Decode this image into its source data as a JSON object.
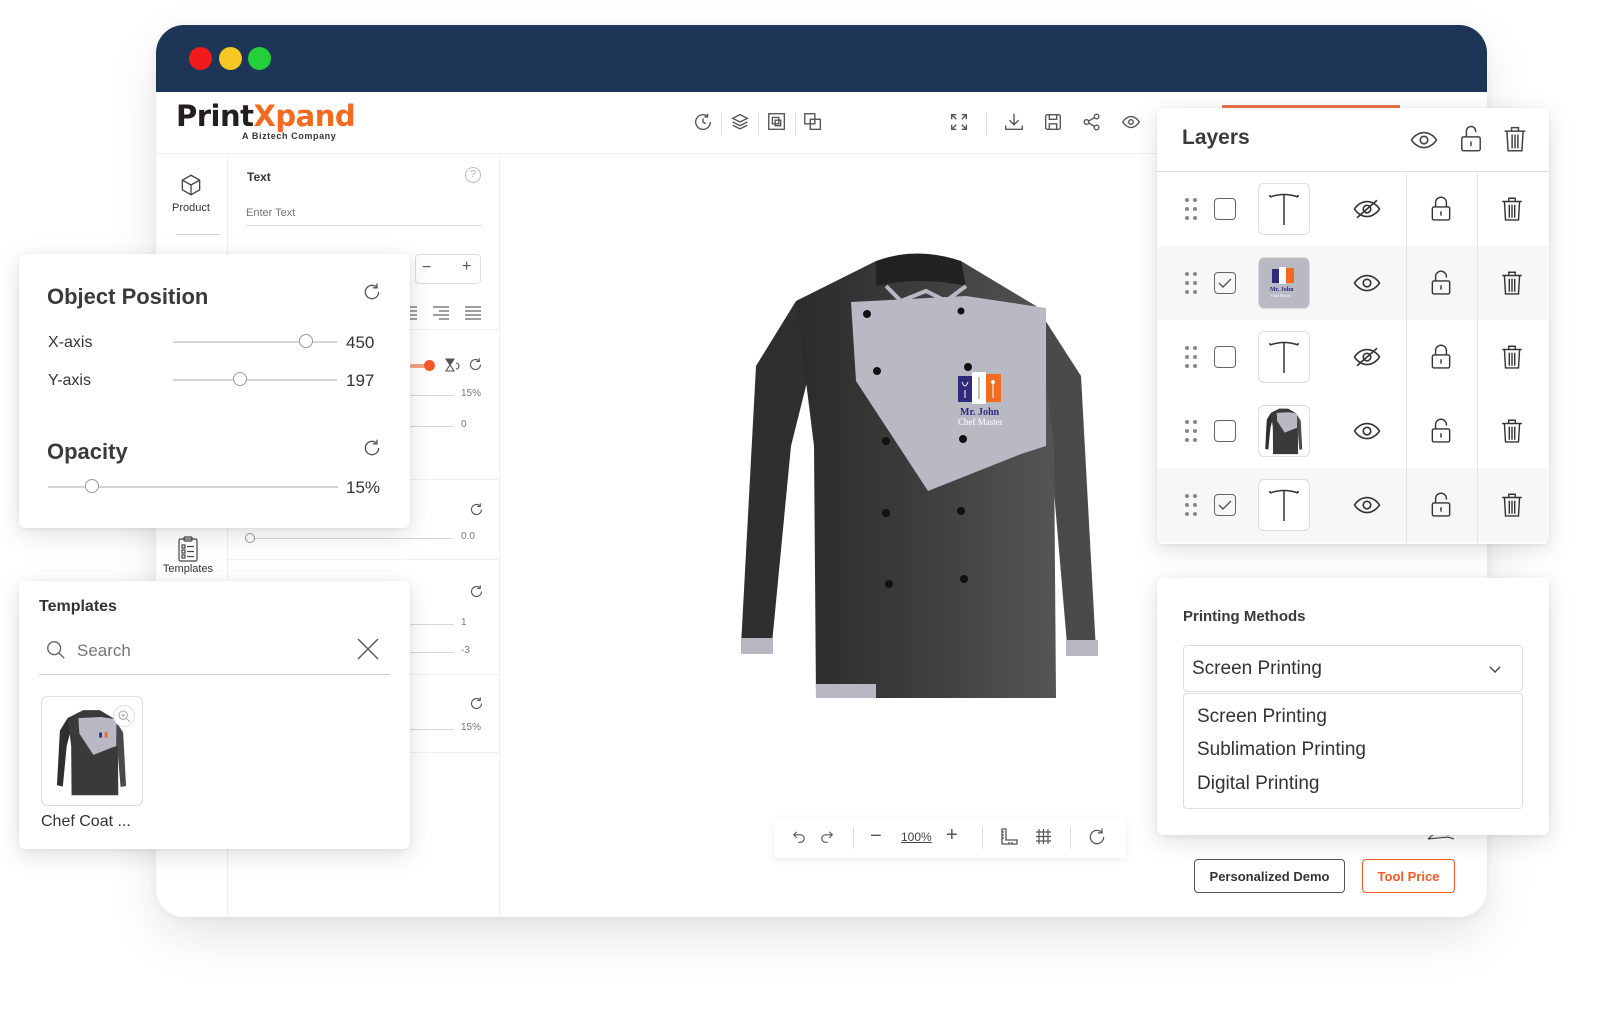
{
  "window": {
    "traffic_lights": {
      "close": "#f11b1b",
      "minimize": "#f7c823",
      "maximize": "#21d03b"
    },
    "titlebar_color": "#1d3557"
  },
  "brand": {
    "name_part1": "Print",
    "name_part2": "Xpand",
    "tagline": "A Biztech Company",
    "accent": "#f26b21"
  },
  "toolbar": {
    "left_icons": [
      "history-icon",
      "layers-icon",
      "bring-front-icon",
      "send-back-icon"
    ],
    "right_icons": [
      "fullscreen-icon",
      "download-icon",
      "save-icon",
      "share-icon",
      "preview-icon"
    ]
  },
  "left_rail": {
    "items": [
      {
        "label": "Product",
        "icon": "cube-icon"
      },
      {
        "label": "Templates",
        "icon": "clipboard-list-icon"
      }
    ]
  },
  "text_panel": {
    "title": "Text",
    "input_placeholder": "Enter Text",
    "help_icon": "?",
    "values": [
      "15%",
      "0",
      "0.0",
      "1",
      "-3",
      "15%"
    ]
  },
  "object_position": {
    "title": "Object Position",
    "x_label": "X-axis",
    "x_value": "450",
    "x_fraction": 0.81,
    "y_label": "Y-axis",
    "y_value": "197",
    "y_fraction": 0.41,
    "opacity_title": "Opacity",
    "opacity_value": "15%",
    "opacity_fraction": 0.15
  },
  "templates": {
    "title": "Templates",
    "search_placeholder": "Search",
    "items": [
      {
        "name": "Chef Coat ..."
      }
    ]
  },
  "canvas": {
    "logo_line1": "Mr. John",
    "logo_line2": "Chef Master"
  },
  "zoom_bar": {
    "zoom_value": "100%"
  },
  "layers": {
    "title": "Layers",
    "rows": [
      {
        "type": "text",
        "checked": false,
        "visible": false,
        "locked": true
      },
      {
        "type": "logo",
        "checked": true,
        "visible": true,
        "locked": false,
        "thumb_text": "Mr. John"
      },
      {
        "type": "text",
        "checked": false,
        "visible": false,
        "locked": true
      },
      {
        "type": "jacket",
        "checked": false,
        "visible": true,
        "locked": false
      },
      {
        "type": "text",
        "checked": true,
        "visible": true,
        "locked": false
      }
    ]
  },
  "printing_methods": {
    "title": "Printing Methods",
    "selected": "Screen Printing",
    "options": [
      "Screen Printing",
      "Sublimation Printing",
      "Digital Printing"
    ]
  },
  "footer_buttons": {
    "demo": "Personalized Demo",
    "price": "Tool Price"
  }
}
